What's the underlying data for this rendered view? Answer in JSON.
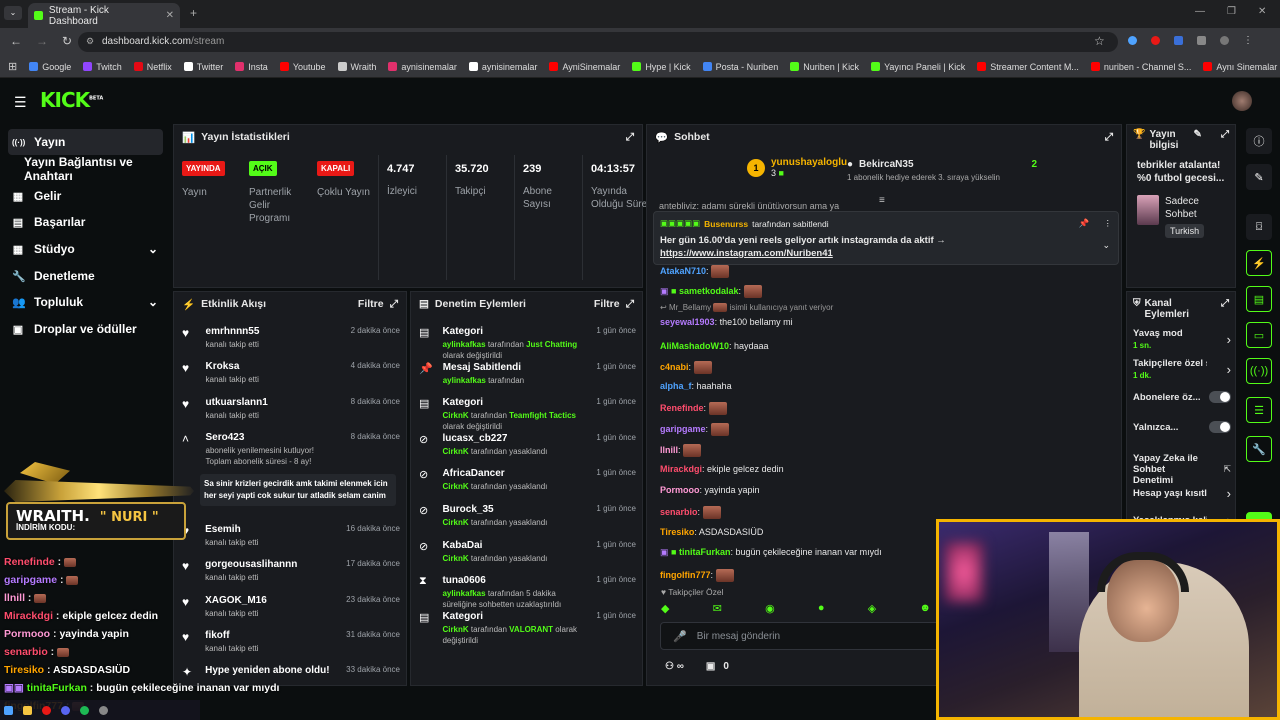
{
  "browser": {
    "tab_title": "Stream - Kick Dashboard",
    "url_host": "dashboard.kick.com",
    "url_path": "/stream",
    "bookmarks": [
      {
        "label": "Google",
        "color": "#4285f4"
      },
      {
        "label": "Twitch",
        "color": "#9146ff"
      },
      {
        "label": "Netflix",
        "color": "#e50914"
      },
      {
        "label": "Twitter",
        "color": "#ffffff"
      },
      {
        "label": "Insta",
        "color": "#e1306c"
      },
      {
        "label": "Youtube",
        "color": "#ff0000"
      },
      {
        "label": "Wraith",
        "color": "#cccccc"
      },
      {
        "label": "aynisinemalar",
        "color": "#e1306c"
      },
      {
        "label": "aynisinemalar",
        "color": "#ffffff"
      },
      {
        "label": "AyniSinemalar",
        "color": "#ff0000"
      },
      {
        "label": "Hype | Kick",
        "color": "#53fc18"
      },
      {
        "label": "Posta - Nuriben",
        "color": "#4285f4"
      },
      {
        "label": "Nuriben | Kick",
        "color": "#53fc18"
      },
      {
        "label": "Yayıncı Paneli | Kick",
        "color": "#53fc18"
      },
      {
        "label": "Streamer Content M...",
        "color": "#ff0000"
      },
      {
        "label": "nuriben - Channel S...",
        "color": "#ff0000"
      },
      {
        "label": "Aynı Sinemalar - Ça...",
        "color": "#ff0000"
      }
    ]
  },
  "header": {
    "logo": "KICK",
    "beta": "BETA"
  },
  "sidebar": [
    {
      "label": "Yayın",
      "icon": "broadcast-icon"
    },
    {
      "label": "Yayın Bağlantısı ve Anahtarı",
      "icon": ""
    },
    {
      "label": "Gelir",
      "icon": "revenue-icon"
    },
    {
      "label": "Başarılar",
      "icon": "trophy-icon"
    },
    {
      "label": "Stüdyo",
      "icon": "studio-icon"
    },
    {
      "label": "Denetleme",
      "icon": "wrench-icon"
    },
    {
      "label": "Topluluk",
      "icon": "users-icon"
    },
    {
      "label": "Droplar ve ödüller",
      "icon": "gift-icon"
    }
  ],
  "stats": {
    "title": "Yayın İstatistikleri",
    "badges": [
      {
        "tag": "YAYINDA",
        "label": "Yayın",
        "color": "#e91916"
      },
      {
        "tag": "AÇIK",
        "label": "Partnerlik Gelir Programı",
        "color": "#53fc18"
      },
      {
        "tag": "KAPALI",
        "label": "Çoklu Yayın",
        "color": "#e91916"
      }
    ],
    "numbers": [
      {
        "value": "4.747",
        "label": "İzleyici"
      },
      {
        "value": "35.720",
        "label": "Takipçi"
      },
      {
        "value": "239",
        "label": "Abone Sayısı"
      },
      {
        "value": "04:13:57",
        "label": "Yayında Olduğu Süre"
      }
    ]
  },
  "activity": {
    "title": "Etkinlik Akışı",
    "filter": "Filtre",
    "items": [
      {
        "name": "emrhnnn55",
        "desc": "kanalı takip etti",
        "time": "2 dakika önce"
      },
      {
        "name": "Kroksa",
        "desc": "kanalı takip etti",
        "time": "4 dakika önce"
      },
      {
        "name": "utkuarslann1",
        "desc": "kanalı takip etti",
        "time": "8 dakika önce"
      },
      {
        "name": "Sero423",
        "desc": "abonelik yenilemesini kutluyor! Toplam abonelik süresi - 8 ay!",
        "time": "8 dakika önce"
      },
      {
        "name": "Esemih",
        "desc": "kanalı takip etti",
        "time": "16 dakika önce"
      },
      {
        "name": "gorgeousaslihannn",
        "desc": "kanalı takip etti",
        "time": "17 dakika önce"
      },
      {
        "name": "XAGOK_M16",
        "desc": "kanalı takip etti",
        "time": "23 dakika önce"
      },
      {
        "name": "fikoff",
        "desc": "kanalı takip etti",
        "time": "31 dakika önce"
      },
      {
        "name": "Hype yeniden abone oldu!",
        "desc": "",
        "time": "33 dakika önce"
      }
    ],
    "sub_message": "Sa sinir krizleri gecirdik amk takimi elenmek icin her seyi yapti cok sukur tur atladik selam canim"
  },
  "moderation": {
    "title": "Denetim Eylemleri",
    "filter": "Filtre",
    "items": [
      {
        "title": "Kategori",
        "who": "aylinkafkas",
        "mid": "tarafından",
        "extra": "Just Chatting",
        "tail": "olarak değiştirildi",
        "time": "1 gün önce",
        "icon": "category-icon"
      },
      {
        "title": "Mesaj Sabitlendi",
        "who": "aylinkafkas",
        "mid": "tarafından",
        "extra": "",
        "tail": "",
        "time": "1 gün önce",
        "icon": "pin-icon"
      },
      {
        "title": "Kategori",
        "who": "CirknK",
        "mid": "tarafından",
        "extra": "Teamfight Tactics",
        "tail": "olarak değiştirildi",
        "time": "1 gün önce",
        "icon": "category-icon"
      },
      {
        "title": "lucasx_cb227",
        "who": "CirknK",
        "mid": "tarafından yasaklandı",
        "extra": "",
        "tail": "",
        "time": "1 gün önce",
        "icon": "ban-icon"
      },
      {
        "title": "AfricaDancer",
        "who": "CirknK",
        "mid": "tarafından yasaklandı",
        "extra": "",
        "tail": "",
        "time": "1 gün önce",
        "icon": "ban-icon"
      },
      {
        "title": "Burock_35",
        "who": "CirknK",
        "mid": "tarafından yasaklandı",
        "extra": "",
        "tail": "",
        "time": "1 gün önce",
        "icon": "ban-icon"
      },
      {
        "title": "KabaDai",
        "who": "CirknK",
        "mid": "tarafından yasaklandı",
        "extra": "",
        "tail": "",
        "time": "1 gün önce",
        "icon": "ban-icon"
      },
      {
        "title": "tuna0606",
        "who": "aylinkafkas",
        "mid": "tarafından 5 dakika süreliğine sohbetten uzaklaştırıldı",
        "extra": "",
        "tail": "",
        "time": "1 gün önce",
        "icon": "timeout-icon"
      },
      {
        "title": "Kategori",
        "who": "CirknK",
        "mid": "tarafından",
        "extra": "VALORANT",
        "tail": "olarak değiştirildi",
        "time": "1 gün önce",
        "icon": "category-icon"
      }
    ]
  },
  "chat": {
    "title": "Sohbet",
    "gifter_left": {
      "name": "yunushayaloglu",
      "count": "3"
    },
    "gifter_right": {
      "name": "BekircaN35",
      "count": "2",
      "note": "1 abonelik hediye ederek 3. sıraya yükselin"
    },
    "pinned": {
      "by": "Busenurss",
      "by_suffix": "tarafından sabitlendi",
      "text": "Her gün 16.00'da yeni reels geliyor artık instagramda da aktif →",
      "link": "https://www.instagram.com/Nuriben41"
    },
    "top_partial": "antebliviz: adamı sürekli ünütüvorsun ama ya",
    "messages": [
      {
        "user": "AtakaN710",
        "color": "#4fa3ff",
        "text": ""
      },
      {
        "user": "sametkodalak",
        "color": "#53fc18",
        "text": ""
      },
      {
        "user": "seyewal1903",
        "color": "#b57bff",
        "text": "the100 bellamy mi"
      },
      {
        "user": "AliMashadoW10",
        "color": "#53fc18",
        "text": "haydaaa"
      },
      {
        "user": "c4nabi",
        "color": "#ffa500",
        "text": ""
      },
      {
        "user": "alpha_f",
        "color": "#4fa3ff",
        "text": "haahaha"
      },
      {
        "user": "Renefinde",
        "color": "#ff4d6d",
        "text": ""
      },
      {
        "user": "garipgame",
        "color": "#b57bff",
        "text": ""
      },
      {
        "user": "llnill",
        "color": "#ff9ad5",
        "text": ""
      },
      {
        "user": "Mirackdgi",
        "color": "#ff4d6d",
        "text": "ekiple gelcez dedin"
      },
      {
        "user": "Pormooo",
        "color": "#ff9ad5",
        "text": "yayinda yapin"
      },
      {
        "user": "senarbio",
        "color": "#ff4d6d",
        "text": ""
      },
      {
        "user": "Tiresiko",
        "color": "#ffa500",
        "text": "ASDASDASIÜD"
      },
      {
        "user": "tinitaFurkan",
        "color": "#53fc18",
        "text": "bugün çekileceğine inanan var mıydı"
      },
      {
        "user": "fingolfin777",
        "color": "#ffa500",
        "text": ""
      }
    ],
    "reply": {
      "to": "Mr_Bellamy",
      "note": "isimli kullanıcıya yanıt veriyor"
    },
    "followers_only": "Takipçiler Özel",
    "input_placeholder": "Bir mesaj gönderin",
    "viewer_count": "0"
  },
  "stream_info": {
    "title": "Yayın bilgisi",
    "stream_title": "tebrikler atalanta! %0 futbol gecesi...",
    "category": "Sadece Sohbet",
    "language": "Turkish"
  },
  "channel_actions": {
    "title": "Kanal Eylemleri",
    "items": [
      {
        "label": "Yavaş mod",
        "sub": "1 sn."
      },
      {
        "label": "Takipçilere özel s",
        "sub": "1 dk."
      },
      {
        "label": "Abonelere öz...",
        "sub": ""
      },
      {
        "label": "Yalnızca...",
        "sub": ""
      },
      {
        "label": "Yapay Zeka ile Sohbet Denetimi",
        "sub": ""
      },
      {
        "label": "Hesap yaşı kısıtla",
        "sub": ""
      },
      {
        "label": "Yasaklanmış kelin",
        "sub": ""
      }
    ]
  },
  "overlay": {
    "brand": "WRAITH.",
    "code_label": "İNDİRİM KODU:",
    "code": "NURI",
    "lines": [
      {
        "user": "Renefinde",
        "color": "#ff4d6d",
        "text": ""
      },
      {
        "user": "garipgame",
        "color": "#b57bff",
        "text": ""
      },
      {
        "user": "llnill",
        "color": "#ff9ad5",
        "text": ""
      },
      {
        "user": "Mirackdgi",
        "color": "#ff4d6d",
        "text": "ekiple gelcez dedin"
      },
      {
        "user": "Pormooo",
        "color": "#ff9ad5",
        "text": "yayinda yapin"
      },
      {
        "user": "senarbio",
        "color": "#ff4d6d",
        "text": ""
      },
      {
        "user": "Tiresiko",
        "color": "#ffa500",
        "text": "ASDASDASIÜD"
      },
      {
        "user": "tinitaFurkan",
        "color": "#53fc18",
        "text": "bugün çekileceğine inanan var mıydı"
      },
      {
        "user": "fingolfin777",
        "color": "#ffa500",
        "text": ""
      }
    ]
  }
}
